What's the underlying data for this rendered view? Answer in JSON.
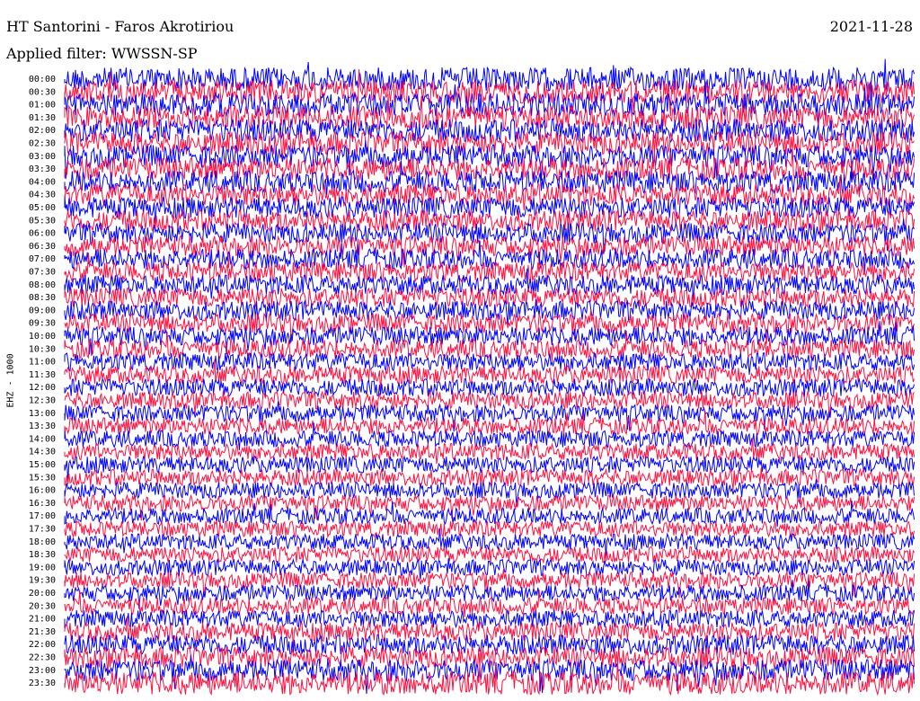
{
  "header": {
    "station": "HT Santorini - Faros Akrotiriou",
    "date": "2021-11-28",
    "filter": "Applied filter: WWSSN-SP"
  },
  "chart_data": {
    "type": "line",
    "title": "HT Santorini - Faros Akrotiriou",
    "subtitle": "Applied filter: WWSSN-SP",
    "ylabel": "EHZ - 1000",
    "rows": [
      "00:00",
      "00:30",
      "01:00",
      "01:30",
      "02:00",
      "02:30",
      "03:00",
      "03:30",
      "04:00",
      "04:30",
      "05:00",
      "05:30",
      "06:00",
      "06:30",
      "07:00",
      "07:30",
      "08:00",
      "08:30",
      "09:00",
      "09:30",
      "10:00",
      "10:30",
      "11:00",
      "11:30",
      "12:00",
      "12:30",
      "13:00",
      "13:30",
      "14:00",
      "14:30",
      "15:00",
      "15:30",
      "16:00",
      "16:30",
      "17:00",
      "17:30",
      "18:00",
      "18:30",
      "19:00",
      "19:30",
      "20:00",
      "20:30",
      "21:00",
      "21:30",
      "22:00",
      "22:30",
      "23:00",
      "23:30"
    ],
    "row_colors": [
      "#0000ff",
      "#ff1040"
    ],
    "relative_amplitude": [
      1.0,
      1.0,
      0.98,
      0.97,
      0.96,
      0.95,
      0.93,
      0.9,
      0.88,
      0.85,
      0.8,
      0.75,
      0.72,
      0.7,
      0.68,
      0.66,
      0.64,
      0.62,
      0.62,
      0.6,
      0.58,
      0.56,
      0.5,
      0.48,
      0.45,
      0.42,
      0.4,
      0.38,
      0.38,
      0.38,
      0.38,
      0.36,
      0.34,
      0.32,
      0.3,
      0.3,
      0.3,
      0.3,
      0.32,
      0.34,
      0.36,
      0.4,
      0.45,
      0.55,
      0.65,
      0.75,
      0.85,
      0.95
    ],
    "grid": false
  }
}
